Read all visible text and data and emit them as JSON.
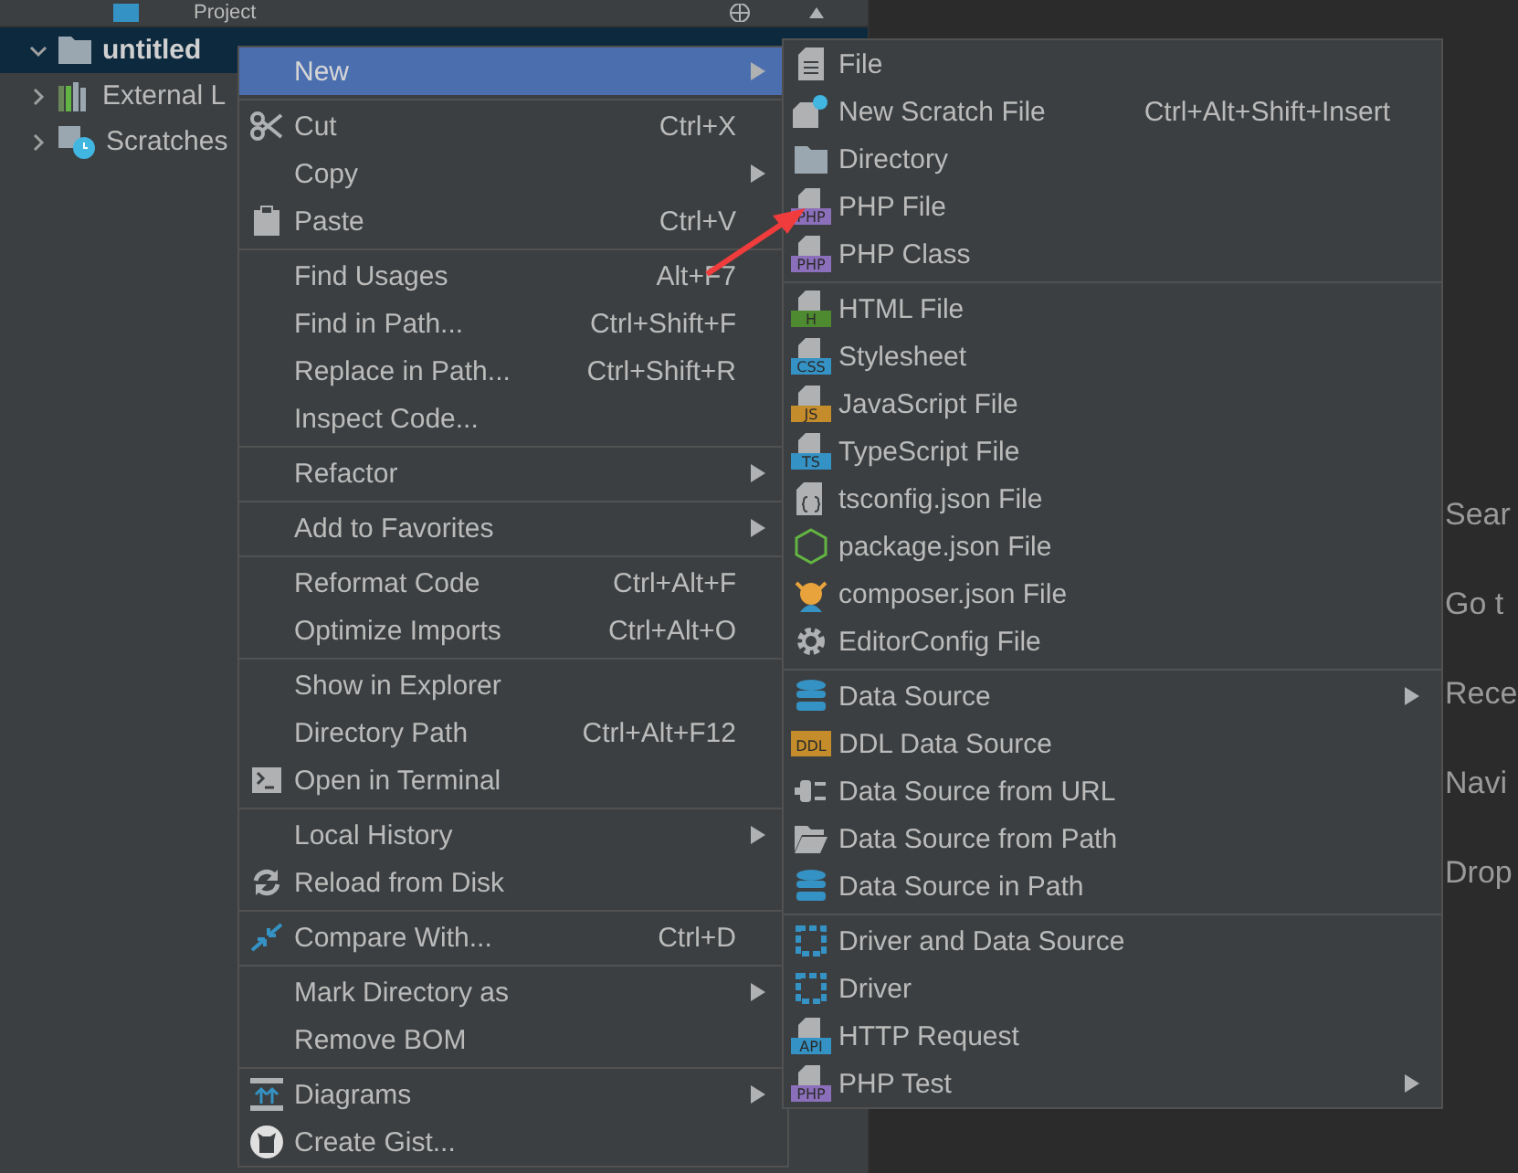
{
  "project_panel": {
    "title": "Project",
    "tree": [
      {
        "label": "untitled",
        "expanded": true,
        "selected": true,
        "kind": "folder"
      },
      {
        "label": "External L",
        "expanded": false,
        "selected": false,
        "kind": "library"
      },
      {
        "label": "Scratches",
        "expanded": false,
        "selected": false,
        "kind": "scratches"
      }
    ]
  },
  "editor_hints": [
    "Sear",
    "Go t",
    "Rece",
    "Navi",
    "Drop"
  ],
  "context_menu": {
    "groups": [
      [
        {
          "label": "New",
          "selected": true,
          "submenu": true
        }
      ],
      [
        {
          "label": "Cut",
          "shortcut": "Ctrl+X",
          "kind": "scissors",
          "selected": false
        },
        {
          "label": "Copy",
          "submenu": true,
          "selected": false
        },
        {
          "label": "Paste",
          "shortcut": "Ctrl+V",
          "kind": "clipboard",
          "selected": false
        }
      ],
      [
        {
          "label": "Find Usages",
          "shortcut": "Alt+F7",
          "selected": false
        },
        {
          "label": "Find in Path...",
          "shortcut": "Ctrl+Shift+F",
          "selected": false
        },
        {
          "label": "Replace in Path...",
          "shortcut": "Ctrl+Shift+R",
          "selected": false
        },
        {
          "label": "Inspect Code...",
          "selected": false
        }
      ],
      [
        {
          "label": "Refactor",
          "submenu": true,
          "selected": false
        }
      ],
      [
        {
          "label": "Add to Favorites",
          "submenu": true,
          "selected": false
        }
      ],
      [
        {
          "label": "Reformat Code",
          "shortcut": "Ctrl+Alt+F",
          "selected": false
        },
        {
          "label": "Optimize Imports",
          "shortcut": "Ctrl+Alt+O",
          "selected": false
        }
      ],
      [
        {
          "label": "Show in Explorer",
          "selected": false
        },
        {
          "label": "Directory Path",
          "shortcut": "Ctrl+Alt+F12",
          "selected": false
        },
        {
          "label": "Open in Terminal",
          "kind": "terminal",
          "selected": false
        }
      ],
      [
        {
          "label": "Local History",
          "submenu": true,
          "selected": false
        },
        {
          "label": "Reload from Disk",
          "kind": "reload",
          "selected": false
        }
      ],
      [
        {
          "label": "Compare With...",
          "shortcut": "Ctrl+D",
          "kind": "compare",
          "selected": false
        }
      ],
      [
        {
          "label": "Mark Directory as",
          "submenu": true,
          "selected": false
        },
        {
          "label": "Remove BOM",
          "selected": false
        }
      ],
      [
        {
          "label": "Diagrams",
          "submenu": true,
          "kind": "diagram",
          "selected": false
        },
        {
          "label": "Create Gist...",
          "kind": "cat-logo",
          "selected": false
        }
      ]
    ]
  },
  "new_submenu": {
    "groups": [
      [
        {
          "label": "File",
          "kind": "file"
        },
        {
          "label": "New Scratch File",
          "shortcut": "Ctrl+Alt+Shift+Insert",
          "kind": "scratch"
        },
        {
          "label": "Directory",
          "kind": "folder"
        },
        {
          "label": "PHP File",
          "kind": "badge-file",
          "badge": "PHP",
          "color": "#8c6fba"
        },
        {
          "label": "PHP Class",
          "kind": "badge-file",
          "badge": "PHP",
          "color": "#8c6fba"
        }
      ],
      [
        {
          "label": "HTML File",
          "kind": "badge-file",
          "badge": "H",
          "color": "#4e8a2f"
        },
        {
          "label": "Stylesheet",
          "kind": "badge-file",
          "badge": "CSS",
          "color": "#3592c4"
        },
        {
          "label": "JavaScript File",
          "kind": "badge-file",
          "badge": "JS",
          "color": "#c48c2a"
        },
        {
          "label": "TypeScript File",
          "kind": "badge-file",
          "badge": "TS",
          "color": "#3592c4"
        },
        {
          "label": "tsconfig.json File",
          "kind": "braces-file"
        },
        {
          "label": "package.json File",
          "kind": "hexagon"
        },
        {
          "label": "composer.json File",
          "kind": "figure"
        },
        {
          "label": "EditorConfig File",
          "kind": "gear"
        }
      ],
      [
        {
          "label": "Data Source",
          "kind": "database",
          "submenu": true
        },
        {
          "label": "DDL Data Source",
          "kind": "badge",
          "badge": "DDL",
          "color": "#c48c2a"
        },
        {
          "label": "Data Source from URL",
          "kind": "plug"
        },
        {
          "label": "Data Source from Path",
          "kind": "open-folder"
        },
        {
          "label": "Data Source in Path",
          "kind": "database"
        }
      ],
      [
        {
          "label": "Driver and Data Source",
          "kind": "driver"
        },
        {
          "label": "Driver",
          "kind": "driver"
        },
        {
          "label": "HTTP Request",
          "kind": "badge-file",
          "badge": "API",
          "color": "#3592c4"
        },
        {
          "label": "PHP Test",
          "kind": "badge-file",
          "badge": "PHP",
          "color": "#8c6fba",
          "submenu": true
        }
      ]
    ]
  },
  "annotation": {
    "kind": "arrow"
  }
}
